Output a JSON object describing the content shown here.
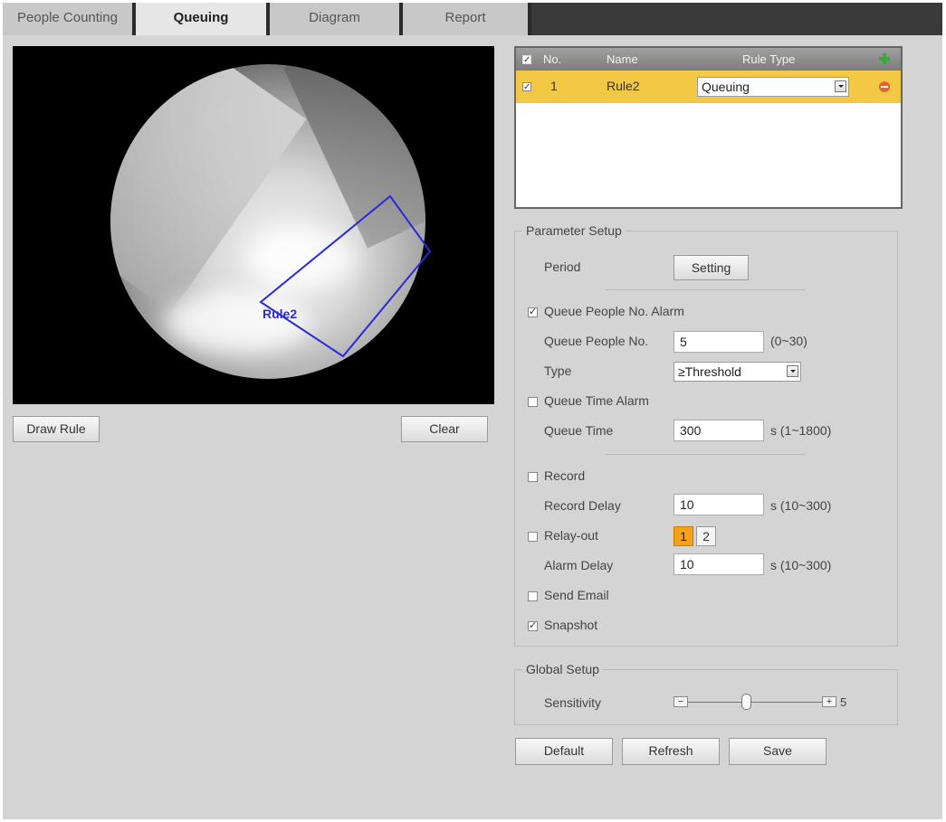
{
  "tabs": [
    {
      "label": "People Counting",
      "active": false
    },
    {
      "label": "Queuing",
      "active": true
    },
    {
      "label": "Diagram",
      "active": false
    },
    {
      "label": "Report",
      "active": false
    }
  ],
  "video": {
    "rule_overlay_label": "Rule2",
    "draw_rule_label": "Draw Rule",
    "clear_label": "Clear"
  },
  "rule_table": {
    "headers": {
      "no": "No.",
      "name": "Name",
      "rule_type": "Rule Type"
    },
    "rows": [
      {
        "no": "1",
        "name": "Rule2",
        "rule_type": "Queuing",
        "checked": true
      }
    ]
  },
  "parameter_setup": {
    "title": "Parameter Setup",
    "period_label": "Period",
    "setting_button": "Setting",
    "queue_people_alarm_label": "Queue People No. Alarm",
    "queue_people_alarm_checked": true,
    "queue_people_no_label": "Queue People No.",
    "queue_people_no_value": "5",
    "queue_people_no_range": "(0~30)",
    "type_label": "Type",
    "type_value": "≥Threshold",
    "queue_time_alarm_label": "Queue Time Alarm",
    "queue_time_alarm_checked": false,
    "queue_time_label": "Queue Time",
    "queue_time_value": "300",
    "queue_time_range": "s (1~1800)",
    "record_label": "Record",
    "record_checked": false,
    "record_delay_label": "Record Delay",
    "record_delay_value": "10",
    "record_delay_range": "s (10~300)",
    "relay_out_label": "Relay-out",
    "relay_out_checked": false,
    "relay_buttons": [
      "1",
      "2"
    ],
    "relay_selected": "1",
    "alarm_delay_label": "Alarm Delay",
    "alarm_delay_value": "10",
    "alarm_delay_range": "s (10~300)",
    "send_email_label": "Send Email",
    "send_email_checked": false,
    "snapshot_label": "Snapshot",
    "snapshot_checked": true
  },
  "global_setup": {
    "title": "Global Setup",
    "sensitivity_label": "Sensitivity",
    "sensitivity_value": "5",
    "sensitivity_min_symbol": "−",
    "sensitivity_max_symbol": "+"
  },
  "footer": {
    "default_label": "Default",
    "refresh_label": "Refresh",
    "save_label": "Save"
  },
  "colors": {
    "selected_row": "#f2c845",
    "overlay_rule": "#2a2ad8",
    "add_icon": "#3aa83a",
    "delete_icon": "#e8622a",
    "relay_active": "#f2a21e"
  }
}
